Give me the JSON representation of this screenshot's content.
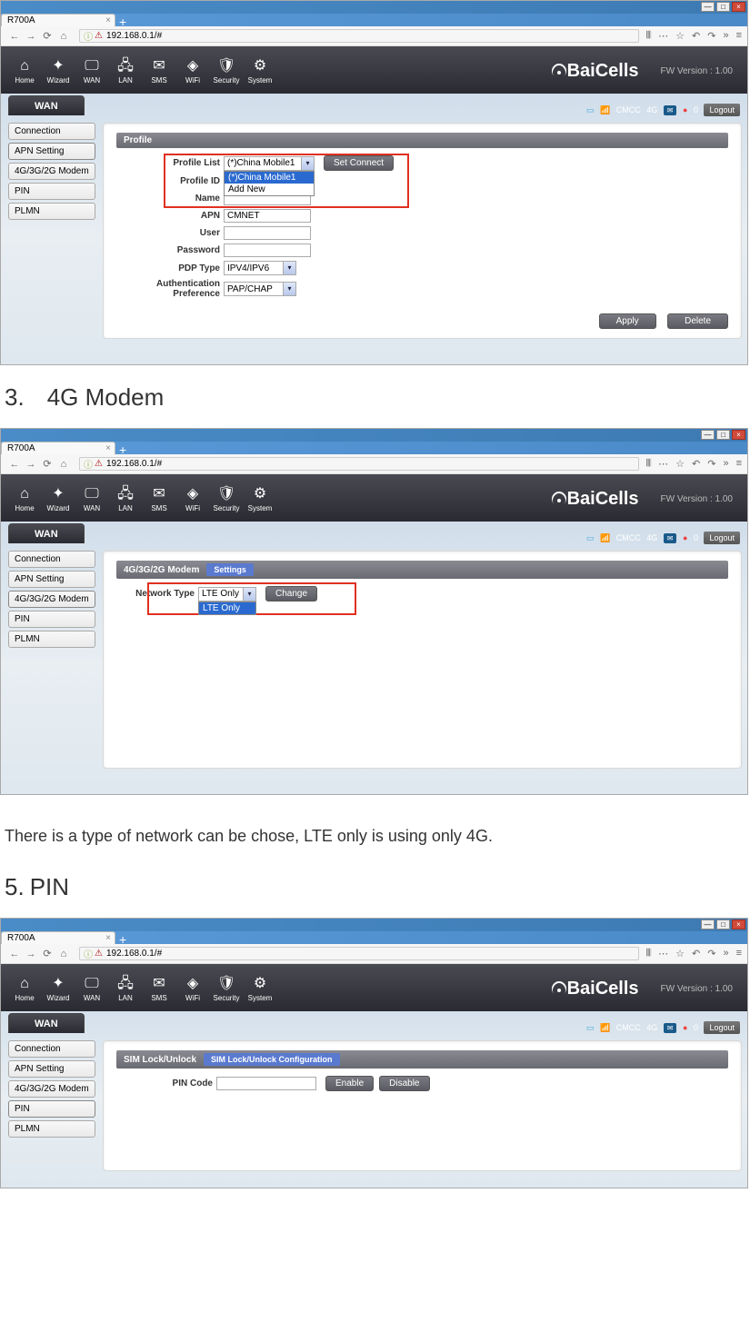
{
  "sections": {
    "s3": {
      "num": "3.",
      "title": "4G Modem"
    },
    "between34": "There is a type of network can be chose, LTE only is using only 4G.",
    "s5": {
      "num": "5.",
      "title": "PIN"
    }
  },
  "browser": {
    "tab_title": "R700A",
    "url": "192.168.0.1/#",
    "win_min": "—",
    "win_max": "□",
    "win_close": "×",
    "tab_close": "×",
    "tab_plus": "+",
    "nav": {
      "back": "←",
      "fwd": "→",
      "reload": "⟳",
      "home": "⌂"
    },
    "right_icons": [
      "𝄃𝄃",
      "⋯",
      "☆",
      "↶",
      "↷",
      "»",
      "≡"
    ]
  },
  "router": {
    "nav": {
      "home": "Home",
      "wizard": "Wizard",
      "wan": "WAN",
      "lan": "LAN",
      "sms": "SMS",
      "wifi": "WiFi",
      "security": "Security",
      "system": "System"
    },
    "brand": "BaiCells",
    "fw_version": "FW Version : 1.00",
    "section_tab": "WAN",
    "status": {
      "cmcc": "CMCC",
      "gen": "4G",
      "msgs": "0",
      "logout": "Logout"
    },
    "sidebar": [
      "Connection",
      "APN Setting",
      "4G/3G/2G Modem",
      "PIN",
      "PLMN"
    ]
  },
  "shot1": {
    "panel_title": "Profile",
    "fields": {
      "profile_list": "Profile List",
      "profile_id": "Profile ID",
      "name": "Name",
      "apn": "APN",
      "user": "User",
      "password": "Password",
      "pdp_type": "PDP Type",
      "auth_pref": "Authentication Preference"
    },
    "values": {
      "profile_list": "(*)China Mobile1",
      "dropdown_opt1": "(*)China Mobile1",
      "dropdown_opt2": "Add New",
      "apn": "CMNET",
      "pdp_type": "IPV4/IPV6",
      "auth_pref": "PAP/CHAP"
    },
    "buttons": {
      "set_connect": "Set Connect",
      "apply": "Apply",
      "delete": "Delete"
    }
  },
  "shot2": {
    "panel_title": "4G/3G/2G Modem",
    "sub_tab": "Settings",
    "fields": {
      "network_type": "Network Type"
    },
    "values": {
      "network_type": "LTE Only",
      "dropdown_opt1": "LTE Only"
    },
    "buttons": {
      "change": "Change"
    }
  },
  "shot3": {
    "panel_title": "SIM Lock/Unlock",
    "sub_tab": "SIM Lock/Unlock Configuration",
    "fields": {
      "pin_code": "PIN Code"
    },
    "buttons": {
      "enable": "Enable",
      "disable": "Disable"
    }
  }
}
